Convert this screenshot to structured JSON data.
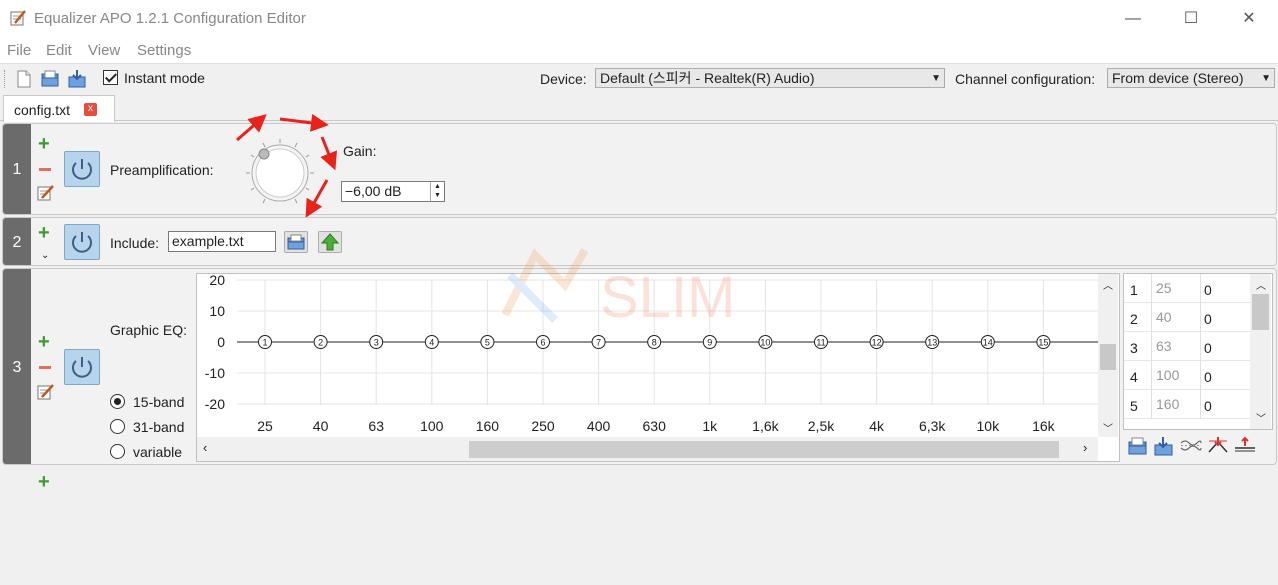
{
  "window": {
    "title": "Equalizer APO 1.2.1 Configuration Editor",
    "minimize": "—",
    "maximize": "☐",
    "close": "✕"
  },
  "menu": [
    "File",
    "Edit",
    "View",
    "Settings"
  ],
  "toolbar": {
    "instant_mode_label": "Instant mode",
    "instant_mode_checked": true,
    "device_label": "Device:",
    "device_value": "Default (스피커 - Realtek(R) Audio)",
    "channel_label": "Channel configuration:",
    "channel_value": "From device (Stereo)"
  },
  "tab": {
    "label": "config.txt",
    "close": "x"
  },
  "rows": [
    {
      "number": "1",
      "preamp_label": "Preamplification:",
      "gain_label": "Gain:",
      "gain_value": "−6,00 dB"
    },
    {
      "number": "2",
      "include_label": "Include:",
      "include_value": "example.txt"
    },
    {
      "number": "3",
      "graphic_eq_label": "Graphic EQ:",
      "band_options": [
        "15-band",
        "31-band",
        "variable"
      ],
      "selected_band_option": "15-band"
    }
  ],
  "graph": {
    "y_ticks": [
      "20",
      "10",
      "0",
      "-10",
      "-20"
    ],
    "x_ticks": [
      "25",
      "40",
      "63",
      "100",
      "160",
      "250",
      "400",
      "630",
      "1k",
      "1,6k",
      "2,5k",
      "4k",
      "6,3k",
      "10k",
      "16k"
    ],
    "nodes": [
      "1",
      "2",
      "3",
      "4",
      "5",
      "6",
      "7",
      "8",
      "9",
      "10",
      "11",
      "12",
      "13",
      "14",
      "15"
    ],
    "gains_db": [
      0,
      0,
      0,
      0,
      0,
      0,
      0,
      0,
      0,
      0,
      0,
      0,
      0,
      0,
      0
    ],
    "ylim": [
      -20,
      20
    ]
  },
  "band_table": [
    {
      "index": "1",
      "freq": "25",
      "gain": "0"
    },
    {
      "index": "2",
      "freq": "40",
      "gain": "0"
    },
    {
      "index": "3",
      "freq": "63",
      "gain": "0"
    },
    {
      "index": "4",
      "freq": "100",
      "gain": "0"
    },
    {
      "index": "5",
      "freq": "160",
      "gain": "0"
    }
  ],
  "colors": {
    "accent_green": "#3a9c2d",
    "remove_red": "#e57058",
    "annotation_arrow": "#e8231c",
    "power_button_bg": "#b8d4ec"
  }
}
